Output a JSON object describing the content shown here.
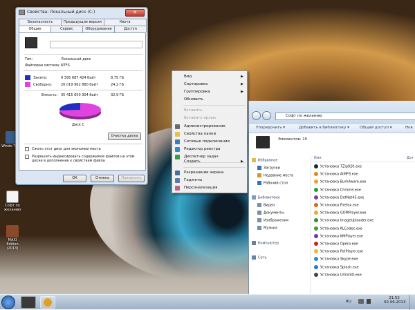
{
  "desktop": {
    "icons": [
      {
        "label": "Windo Twea"
      },
      {
        "label": "Софт по желанию"
      },
      {
        "label": "MAXI Edition (2013)"
      }
    ]
  },
  "props": {
    "title": "Свойства: Локальный диск (C:)",
    "close": "✕",
    "tabs_top": [
      "Безопасность",
      "Предыдущие версии",
      "Квота"
    ],
    "tabs_bottom": [
      "Общие",
      "Сервис",
      "Оборудование",
      "Доступ"
    ],
    "type_label": "Тип:",
    "type_value": "Локальный диск",
    "fs_label": "Файловая система:",
    "fs_value": "NTFS",
    "used_label": "Занято:",
    "used_bytes": "9 395 687 424 байт",
    "used_gb": "8,75 ГБ",
    "free_label": "Свободно:",
    "free_bytes": "26 019 962 880 байт",
    "free_gb": "24,2 ГБ",
    "cap_label": "Емкость:",
    "cap_bytes": "35 415 650 304 байт",
    "cap_gb": "32,9 ГБ",
    "used_color": "#1f2fbf",
    "free_color": "#e044e0",
    "used_fraction": 0.265,
    "disk_label": "Диск C",
    "cleanup": "Очистка диска",
    "compress": "Сжать этот диск для экономии места",
    "index": "Разрешить индексировать содержимое файлов на этом диске в дополнение к свойствам файла",
    "ok": "ОК",
    "cancel": "Отмена",
    "apply": "Применить"
  },
  "ctx": {
    "items": [
      {
        "label": "Вид",
        "arrow": "▶",
        "disabled": false
      },
      {
        "label": "Сортировка",
        "arrow": "▶",
        "disabled": false
      },
      {
        "label": "Группировка",
        "arrow": "▶",
        "disabled": false
      },
      {
        "label": "Обновить",
        "disabled": false
      },
      {
        "label": "Вставить",
        "disabled": true
      },
      {
        "label": "Вставить ярлык",
        "disabled": true
      },
      {
        "label": "Администрирование",
        "disabled": false
      },
      {
        "label": "Свойства папки",
        "disabled": false
      },
      {
        "label": "Сетевые подключения",
        "disabled": false
      },
      {
        "label": "Редактор реестра",
        "disabled": false
      },
      {
        "label": "Диспетчер задач",
        "disabled": false
      },
      {
        "label": "Создать",
        "arrow": "▶",
        "disabled": false
      },
      {
        "label": "Разрешение экрана",
        "disabled": false
      },
      {
        "label": "Гаджеты",
        "disabled": false
      },
      {
        "label": "Персонализация",
        "disabled": false
      }
    ]
  },
  "explorer": {
    "address": "Софт по желанию",
    "cmd": [
      "Упорядочить ▾",
      "Добавить в библиотеку ▾",
      "Общий доступ ▾",
      "Нов"
    ],
    "elements": "Элементов: 15",
    "col_name": "Имя",
    "col_date": "Дат",
    "nav": [
      {
        "label": "Избранное",
        "color": "#e8b84a"
      },
      {
        "label": "Загрузки",
        "color": "#3b6fb4"
      },
      {
        "label": "Недавние места",
        "color": "#c89a3a"
      },
      {
        "label": "Рабочий стол",
        "color": "#2f77c4"
      },
      {
        "label": "Библиотеки",
        "color": "#7a9cc6"
      },
      {
        "label": "Видео",
        "color": "#7a8fa6"
      },
      {
        "label": "Документы",
        "color": "#7a8fa6"
      },
      {
        "label": "Изображения",
        "color": "#7a8fa6"
      },
      {
        "label": "Музыка",
        "color": "#7a8fa6"
      },
      {
        "label": "Компьютер",
        "color": "#6d7f92"
      },
      {
        "label": "Сеть",
        "color": "#5f85b0"
      }
    ],
    "files": [
      {
        "name": "Установка 7Zip920.exe",
        "color": "#222"
      },
      {
        "name": "Установка AIMP3.exe",
        "color": "#e08a1e"
      },
      {
        "name": "Установка BurnAware.exe",
        "color": "#f0a030"
      },
      {
        "name": "Установка Chrome.exe",
        "color": "#2f9a3a"
      },
      {
        "name": "Установка DotNet45.exe",
        "color": "#7a3fa0"
      },
      {
        "name": "Установка Firefox.exe",
        "color": "#e0601e"
      },
      {
        "name": "Установка GOMPlayer.exe",
        "color": "#e8b020"
      },
      {
        "name": "Установка ImageUploader.exe",
        "color": "#3a8a3a"
      },
      {
        "name": "Установка KLCodec.exe",
        "color": "#3aa030"
      },
      {
        "name": "Установка KMPlayer.exe",
        "color": "#7a2fb0"
      },
      {
        "name": "Установка Opera.exe",
        "color": "#d02020"
      },
      {
        "name": "Установка PotPlayer.exe",
        "color": "#e0c020"
      },
      {
        "name": "Установка Skype.exe",
        "color": "#1e90d8"
      },
      {
        "name": "Установка Splash.exe",
        "color": "#3a6fd0"
      },
      {
        "name": "Установка UltraISO.exe",
        "color": "#444"
      }
    ]
  },
  "taskbar": {
    "lang": "RU",
    "time": "21:52",
    "date": "02.06.2013"
  }
}
